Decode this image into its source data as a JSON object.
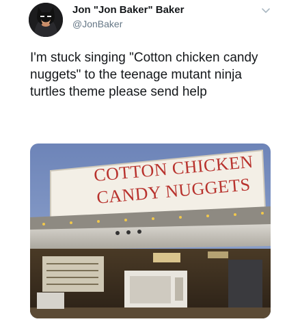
{
  "tweet": {
    "display_name": "Jon \"Jon Baker\" Baker",
    "handle": "@JonBaker",
    "text": "I'm stuck singing \"Cotton chicken candy nuggets\" to the teenage mutant ninja turtles theme please send help",
    "menu_icon": "chevron-down-icon"
  },
  "photo": {
    "sign_line_1": "COTTON CHICKEN",
    "sign_line_2": "CANDY NUGGETS"
  }
}
